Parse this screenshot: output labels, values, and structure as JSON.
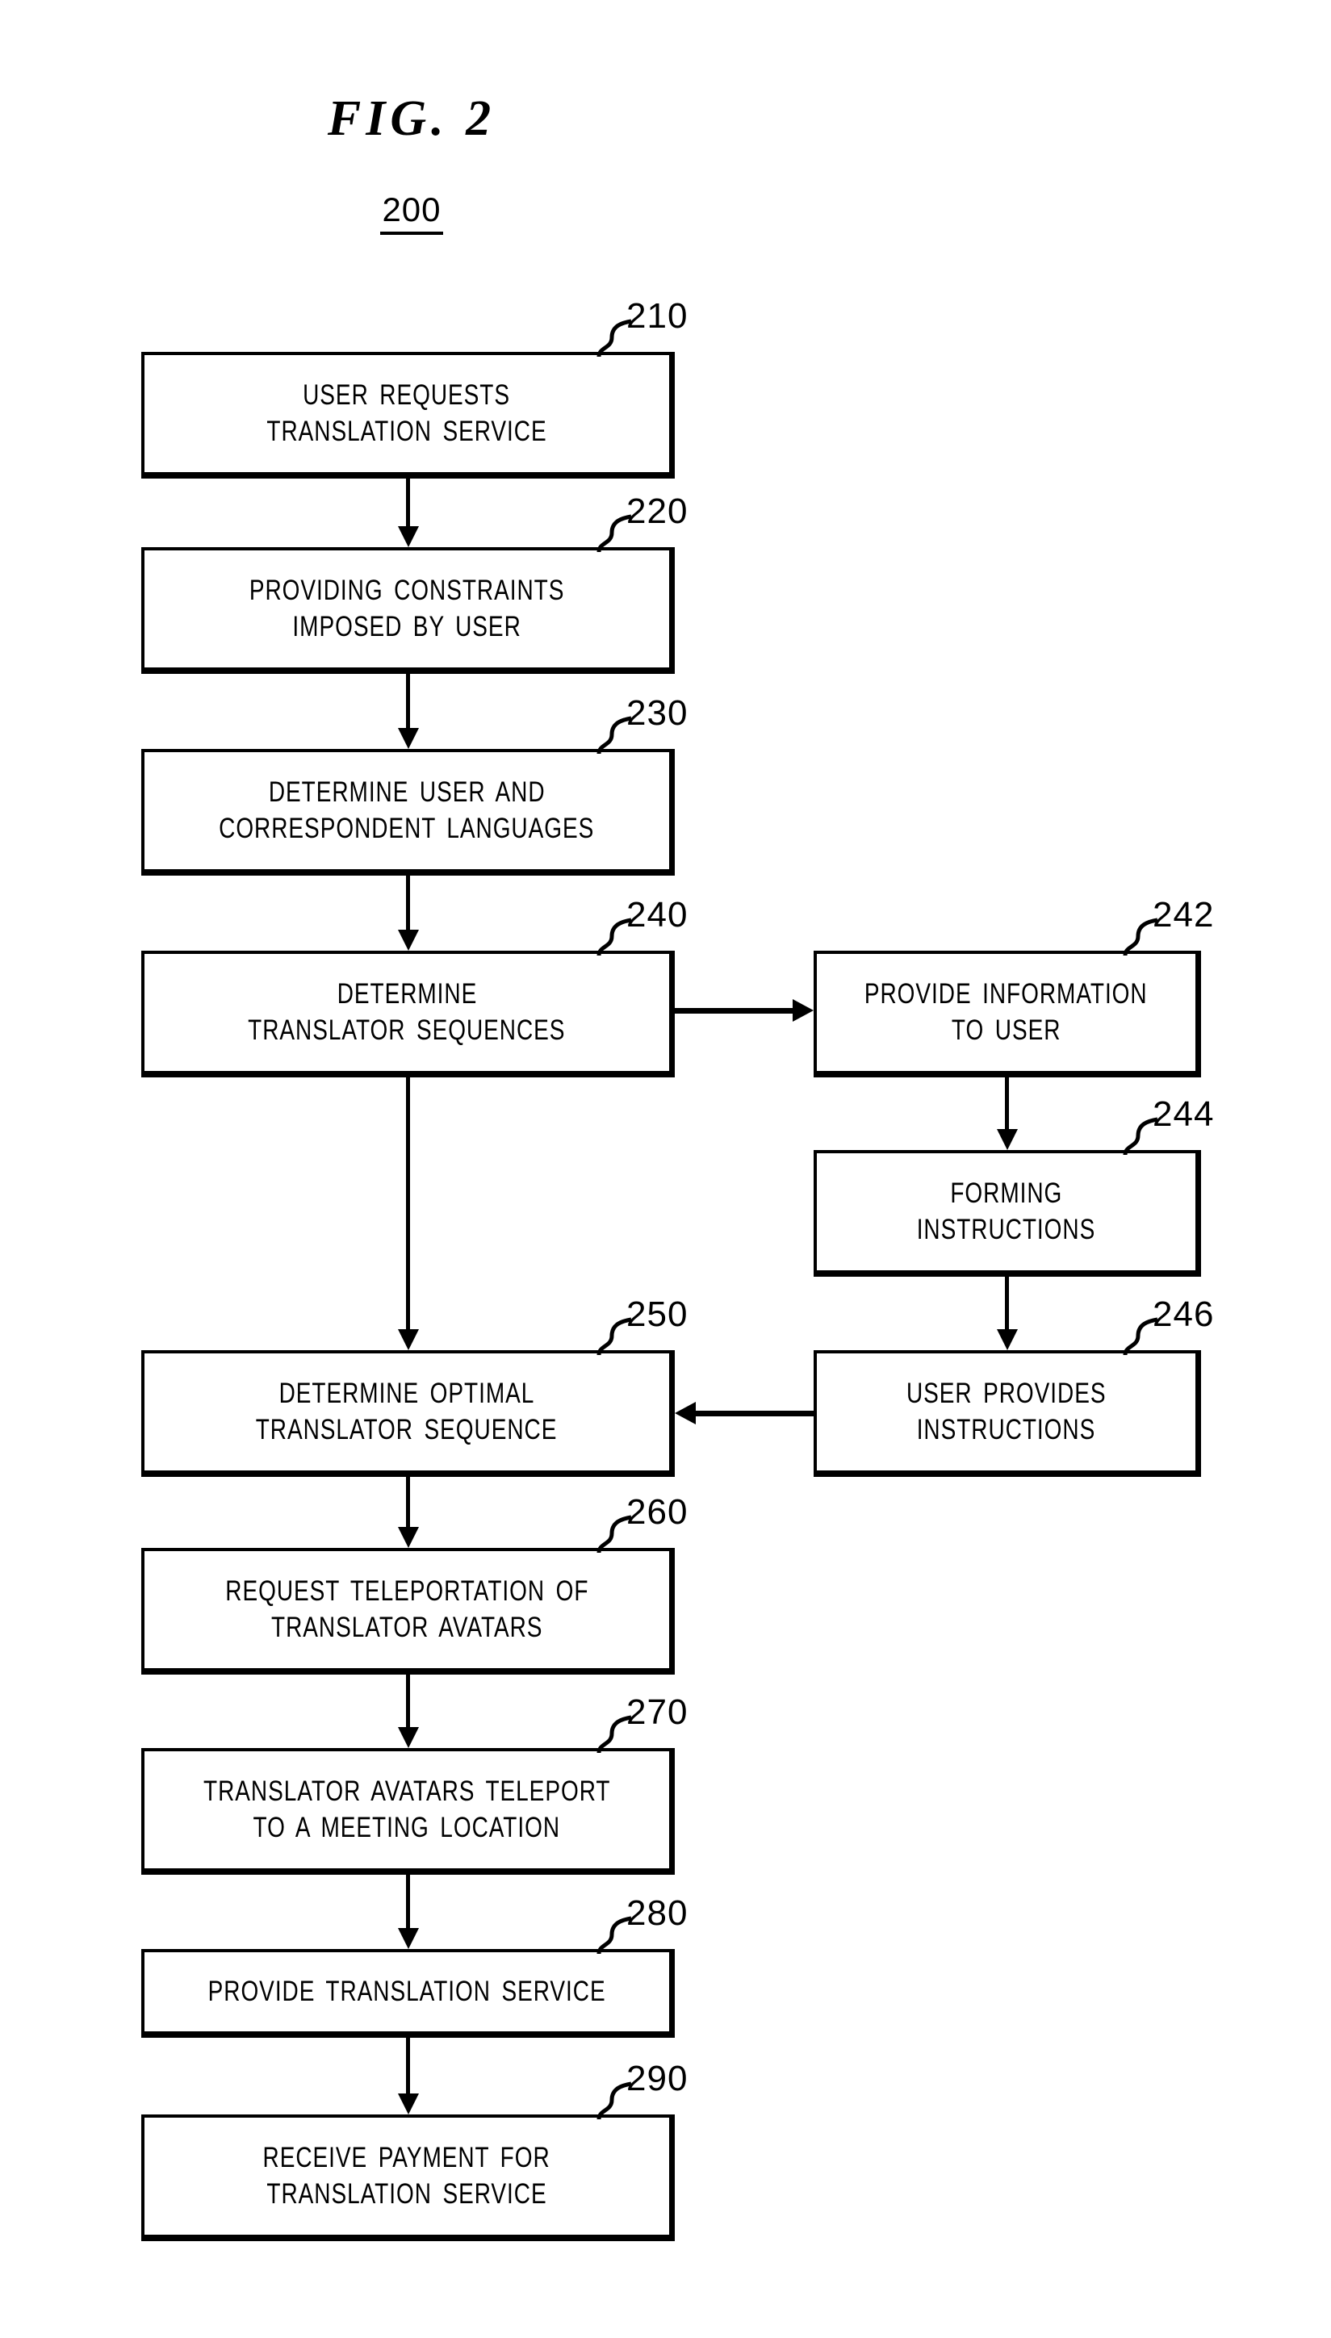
{
  "figure": {
    "title": "FIG.  2",
    "number": "200"
  },
  "flowchart": {
    "type": "flowchart",
    "orientation": "top-to-bottom",
    "nodes": [
      {
        "ref": "210",
        "lines": [
          "USER  REQUESTS",
          "TRANSLATION  SERVICE"
        ],
        "column": "left"
      },
      {
        "ref": "220",
        "lines": [
          "PROVIDING  CONSTRAINTS",
          "IMPOSED  BY  USER"
        ],
        "column": "left"
      },
      {
        "ref": "230",
        "lines": [
          "DETERMINE  USER  AND",
          "CORRESPONDENT  LANGUAGES"
        ],
        "column": "left"
      },
      {
        "ref": "240",
        "lines": [
          "DETERMINE",
          "TRANSLATOR  SEQUENCES"
        ],
        "column": "left"
      },
      {
        "ref": "242",
        "lines": [
          "PROVIDE  INFORMATION",
          "TO  USER"
        ],
        "column": "right"
      },
      {
        "ref": "244",
        "lines": [
          "FORMING",
          "INSTRUCTIONS"
        ],
        "column": "right"
      },
      {
        "ref": "246",
        "lines": [
          "USER  PROVIDES",
          "INSTRUCTIONS"
        ],
        "column": "right"
      },
      {
        "ref": "250",
        "lines": [
          "DETERMINE  OPTIMAL",
          "TRANSLATOR  SEQUENCE"
        ],
        "column": "left"
      },
      {
        "ref": "260",
        "lines": [
          "REQUEST  TELEPORTATION  OF",
          "TRANSLATOR  AVATARS"
        ],
        "column": "left"
      },
      {
        "ref": "270",
        "lines": [
          "TRANSLATOR  AVATARS  TELEPORT",
          "TO  A  MEETING  LOCATION"
        ],
        "column": "left"
      },
      {
        "ref": "280",
        "lines": [
          "PROVIDE  TRANSLATION  SERVICE"
        ],
        "column": "left"
      },
      {
        "ref": "290",
        "lines": [
          "RECEIVE  PAYMENT  FOR",
          "TRANSLATION  SERVICE"
        ],
        "column": "left"
      }
    ],
    "edges": [
      {
        "from": "210",
        "to": "220",
        "direction": "down"
      },
      {
        "from": "220",
        "to": "230",
        "direction": "down"
      },
      {
        "from": "230",
        "to": "240",
        "direction": "down"
      },
      {
        "from": "240",
        "to": "242",
        "direction": "right"
      },
      {
        "from": "240",
        "to": "250",
        "direction": "down"
      },
      {
        "from": "242",
        "to": "244",
        "direction": "down"
      },
      {
        "from": "244",
        "to": "246",
        "direction": "down"
      },
      {
        "from": "246",
        "to": "250",
        "direction": "left"
      },
      {
        "from": "250",
        "to": "260",
        "direction": "down"
      },
      {
        "from": "260",
        "to": "270",
        "direction": "down"
      },
      {
        "from": "270",
        "to": "280",
        "direction": "down"
      },
      {
        "from": "280",
        "to": "290",
        "direction": "down"
      }
    ],
    "colors": {
      "stroke": "#000000",
      "fill": "#ffffff"
    }
  }
}
